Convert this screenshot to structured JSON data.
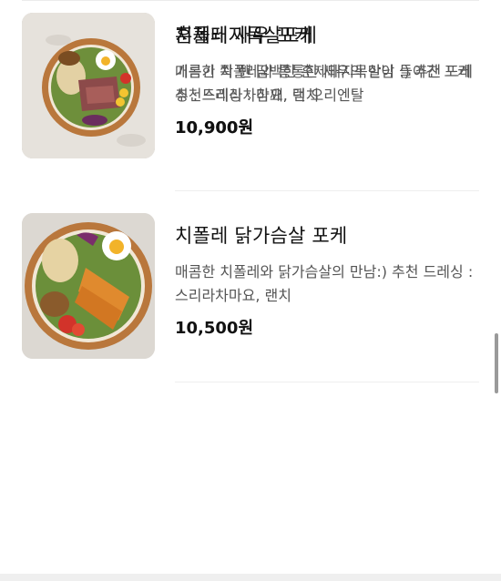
{
  "menu_items": [
    {
      "name": "치폴레 닭가슴살 포케",
      "description": "매콤한 치폴레와 닭가슴살의 만남:) 추천 드레싱 : 스리라차마요, 랜치",
      "price": "10,500원",
      "image_icon": "poke-bowl-chicken-image"
    },
    {
      "name": "치폴레 새우 포케",
      "description": "매콤한 치폴레와 통통한 새우의 만남 :) 추천 드레싱 : 스리라차마요, 랜치",
      "price": "10,900원",
      "image_icon": "poke-bowl-shrimp-image"
    },
    {
      "name": "훈제돼지목살포케",
      "description": "기름기 쫙 뺀 담백한 훈제돼지목살이 들어간 포케 추천드레싱 : 참깨, 덕 오리엔탈",
      "price": "10,900원",
      "image_icon": "poke-bowl-pork-image"
    }
  ],
  "colors": {
    "background": "#ffffff",
    "title": "#111111",
    "description": "#555555",
    "divider": "#eeeeee",
    "bowl": "#c8894a"
  }
}
